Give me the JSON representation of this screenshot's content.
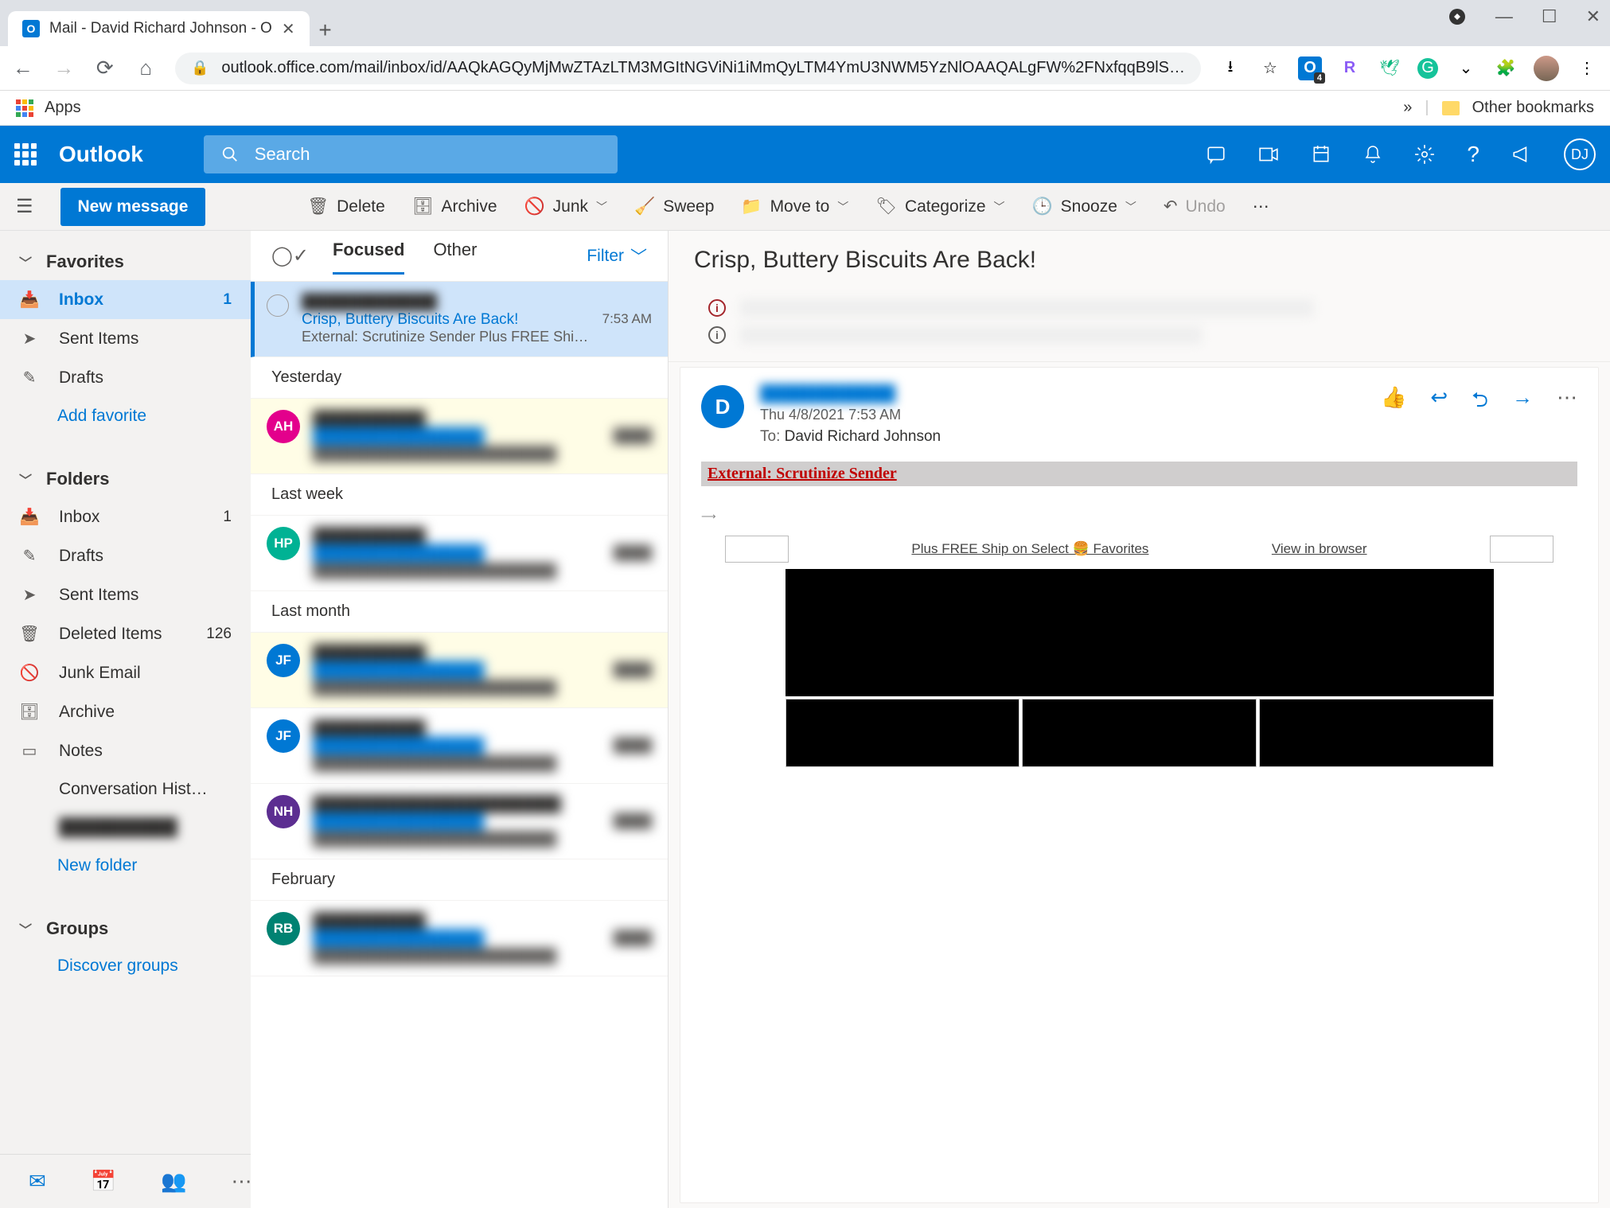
{
  "browser": {
    "tab_title": "Mail - David Richard Johnson - O",
    "url": "outlook.office.com/mail/inbox/id/AAQkAGQyMjMwZTAzLTM3MGItNGViNi1iMmQyLTM4YmU3NWM5YzNlOAAQALgFW%2FNxfqqB9lS…",
    "apps_label": "Apps",
    "other_bookmarks": "Other bookmarks"
  },
  "suite": {
    "title": "Outlook",
    "search_placeholder": "Search",
    "user_initials": "DJ"
  },
  "cmd": {
    "new_message": "New message",
    "delete": "Delete",
    "archive": "Archive",
    "junk": "Junk",
    "sweep": "Sweep",
    "move_to": "Move to",
    "categorize": "Categorize",
    "snooze": "Snooze",
    "undo": "Undo"
  },
  "nav": {
    "favorites": "Favorites",
    "inbox": "Inbox",
    "inbox_count": "1",
    "sent": "Sent Items",
    "drafts": "Drafts",
    "add_favorite": "Add favorite",
    "folders": "Folders",
    "inbox2": "Inbox",
    "inbox2_count": "1",
    "drafts2": "Drafts",
    "sent2": "Sent Items",
    "deleted": "Deleted Items",
    "deleted_count": "126",
    "junk": "Junk Email",
    "archive": "Archive",
    "notes": "Notes",
    "convo": "Conversation Hist…",
    "hidden": "██████████",
    "new_folder": "New folder",
    "groups": "Groups",
    "discover": "Discover groups"
  },
  "list": {
    "focused": "Focused",
    "other": "Other",
    "filter": "Filter",
    "items": [
      {
        "from_blur": "████████████",
        "subject": "Crisp, Buttery Biscuits Are Back!",
        "time": "7:53 AM",
        "preview": "External: Scrutinize Sender Plus FREE Shi…"
      }
    ],
    "headers": {
      "yesterday": "Yesterday",
      "last_week": "Last week",
      "last_month": "Last month",
      "february": "February"
    },
    "avatars": [
      "AH",
      "HP",
      "JF",
      "JF",
      "NH",
      "RB"
    ]
  },
  "read": {
    "title": "Crisp, Buttery Biscuits Are Back!",
    "date": "Thu 4/8/2021 7:53 AM",
    "to_label": "To:",
    "to_name": "David Richard Johnson",
    "from_initial": "D",
    "external_warning": "External: Scrutinize Sender",
    "promo_text": "Plus FREE Ship on Select 🍔 Favorites",
    "view_browser": "View in browser"
  }
}
